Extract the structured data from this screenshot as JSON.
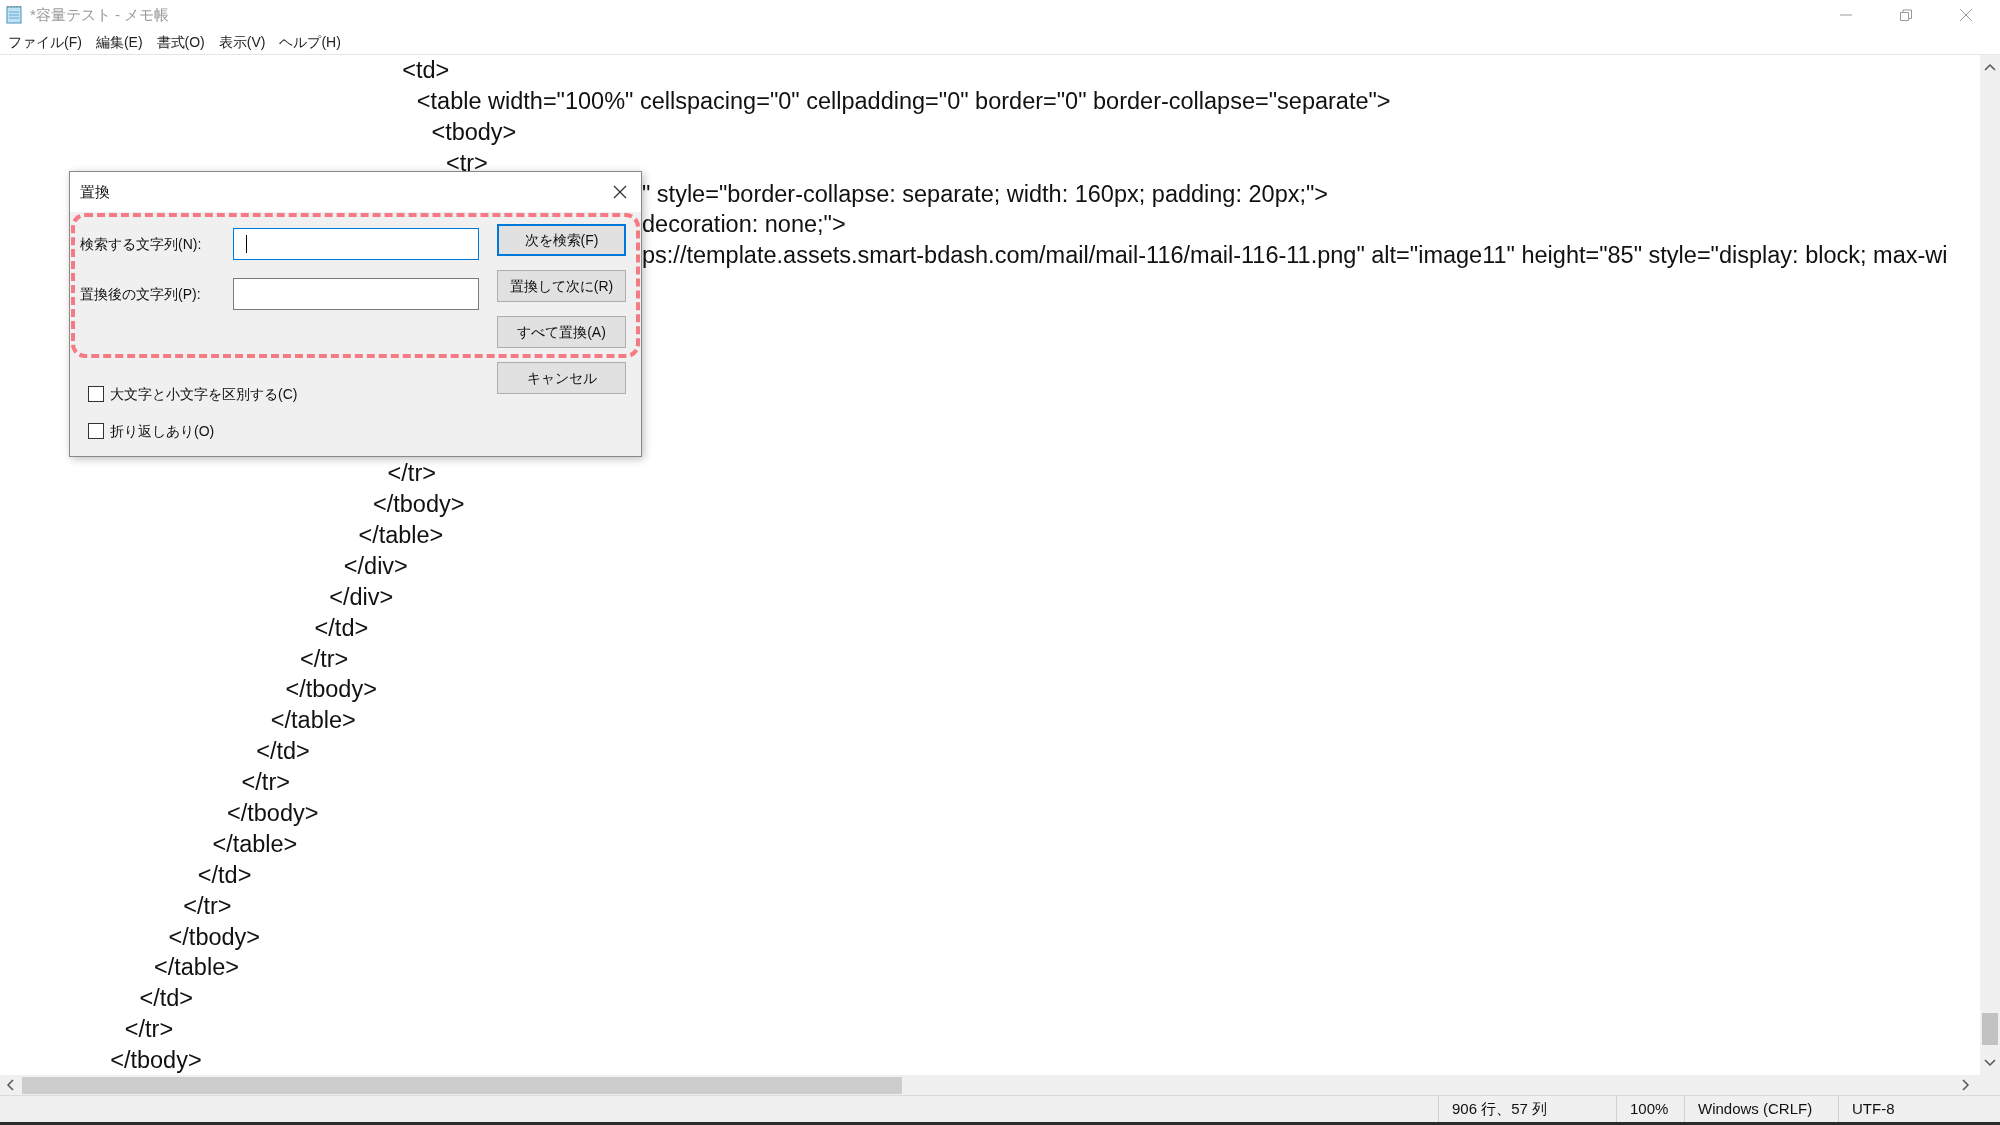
{
  "window": {
    "title": "*容量テスト - メモ帳",
    "active": false
  },
  "menu": [
    "ファイル(F)",
    "編集(E)",
    "書式(O)",
    "表示(V)",
    "ヘルプ(H)"
  ],
  "editor": {
    "lines_above": [
      "\t\t\t\t\t\t\t\t\t\t\t\t\t\t\t\t\t\t\t\t\t\t\t\t\t\t\t<td>",
      "\t\t\t\t\t\t\t\t\t\t\t\t\t\t\t\t\t\t\t\t\t\t\t\t\t\t\t\t<table width=\"100%\" cellspacing=\"0\" cellpadding=\"0\" border=\"0\" border-collapse=\"separate\">",
      "\t\t\t\t\t\t\t\t\t\t\t\t\t\t\t\t\t\t\t\t\t\t\t\t\t\t\t\t\t<tbody>",
      "\t\t\t\t\t\t\t\t\t\t\t\t\t\t\t\t\t\t\t\t\t\t\t\t\t\t\t\t\t\t<tr>"
    ],
    "lines_beside_dialog": [
      "\" style=\"border-collapse: separate; width: 160px; padding: 20px;\">",
      "decoration: none;\">",
      "ps://template.assets.smart-bdash.com/mail/mail-116/mail-116-11.png\" alt=\"image11\" height=\"85\" style=\"display: block; max-wi"
    ],
    "lines_below": [
      "\t\t\t\t\t\t\t\t\t\t\t\t\t\t\t\t\t\t\t\t\t\t\t\t\t\t</tr>",
      "\t\t\t\t\t\t\t\t\t\t\t\t\t\t\t\t\t\t\t\t\t\t\t\t\t</tbody>",
      "\t\t\t\t\t\t\t\t\t\t\t\t\t\t\t\t\t\t\t\t\t\t\t\t</table>",
      "\t\t\t\t\t\t\t\t\t\t\t\t\t\t\t\t\t\t\t\t\t\t\t</div>",
      "\t\t\t\t\t\t\t\t\t\t\t\t\t\t\t\t\t\t\t\t\t\t</div>",
      "\t\t\t\t\t\t\t\t\t\t\t\t\t\t\t\t\t\t\t\t\t</td>",
      "\t\t\t\t\t\t\t\t\t\t\t\t\t\t\t\t\t\t\t\t</tr>",
      "\t\t\t\t\t\t\t\t\t\t\t\t\t\t\t\t\t\t\t</tbody>",
      "\t\t\t\t\t\t\t\t\t\t\t\t\t\t\t\t\t\t</table>",
      "\t\t\t\t\t\t\t\t\t\t\t\t\t\t\t\t\t</td>",
      "\t\t\t\t\t\t\t\t\t\t\t\t\t\t\t\t</tr>",
      "\t\t\t\t\t\t\t\t\t\t\t\t\t\t\t</tbody>",
      "\t\t\t\t\t\t\t\t\t\t\t\t\t\t</table>",
      "\t\t\t\t\t\t\t\t\t\t\t\t\t</td>",
      "\t\t\t\t\t\t\t\t\t\t\t\t</tr>",
      "\t\t\t\t\t\t\t\t\t\t\t</tbody>",
      "\t\t\t\t\t\t\t\t\t\t</table>",
      "\t\t\t\t\t\t\t\t\t</td>",
      "\t\t\t\t\t\t\t\t</tr>",
      "\t\t\t\t\t\t\t</tbody>"
    ]
  },
  "replace_dialog": {
    "title": "置換",
    "fields": [
      {
        "label": "検索する文字列(N):",
        "focused": true
      },
      {
        "label": "置換後の文字列(P):",
        "focused": false
      }
    ],
    "buttons": [
      {
        "label": "次を検索(F)",
        "default": true
      },
      {
        "label": "置換して次に(R)",
        "default": false
      },
      {
        "label": "すべて置換(A)",
        "default": false
      },
      {
        "label": "キャンセル",
        "default": false
      }
    ],
    "checkboxes": [
      {
        "label": "大文字と小文字を区別する(C)",
        "checked": false
      },
      {
        "label": "折り返しあり(O)",
        "checked": false
      }
    ]
  },
  "status_bar": [
    "906 行、57 列",
    "100%",
    "Windows (CRLF)",
    "UTF-8"
  ]
}
